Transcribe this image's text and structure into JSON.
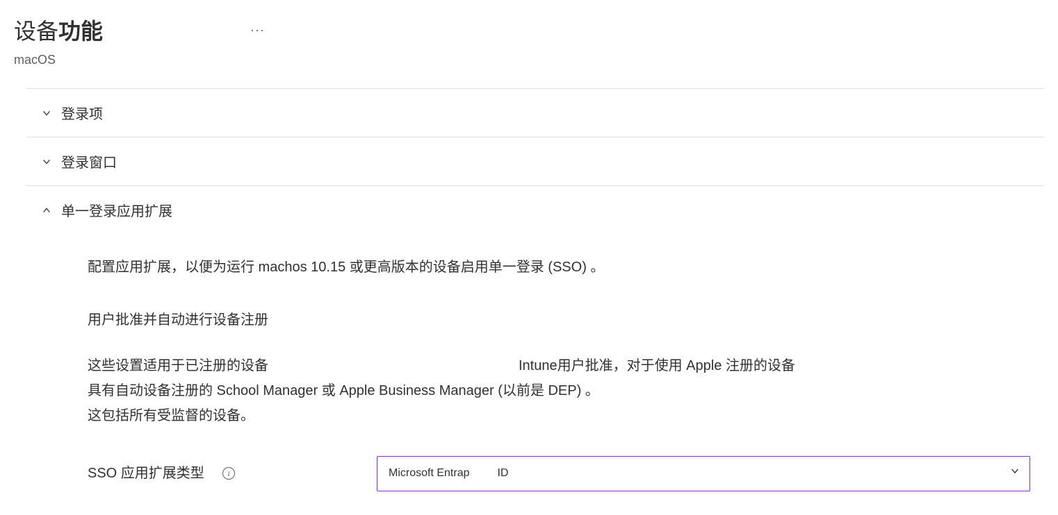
{
  "header": {
    "title_part1": "设备",
    "title_part2": "功能",
    "subtitle": "macOS"
  },
  "sections": {
    "login_items": "登录项",
    "login_window": "登录窗口",
    "sso_extension": "单一登录应用扩展"
  },
  "sso": {
    "description": "配置应用扩展，以便为运行 machos  10.15 或更高版本的设备启用单一登录 (SSO) 。",
    "subheading": "用户批准并自动进行设备注册",
    "body_line1a": "这些设置适用于已注册的设备",
    "body_line1b": "Intune用户批准，对于使用 Apple 注册的设备",
    "body_line2": "具有自动设备注册的 School Manager 或 Apple Business Manager (以前是 DEP) 。",
    "body_line3": "这包括所有受监督的设备。",
    "form": {
      "label": "SSO 应用扩展类型",
      "selected_value_a": "Microsoft Entrap",
      "selected_value_b": "ID"
    }
  }
}
